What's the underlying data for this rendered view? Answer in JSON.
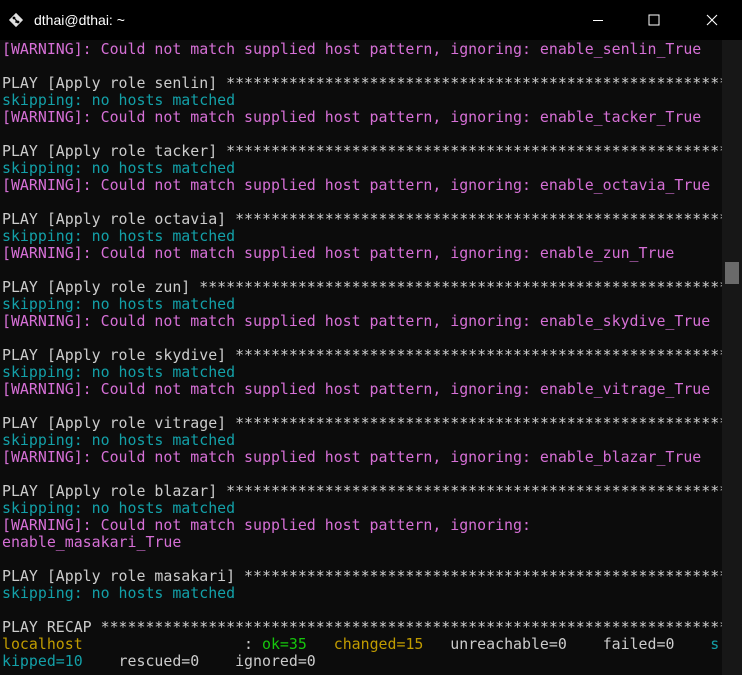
{
  "window": {
    "title": "dthai@dthai: ~"
  },
  "colors": {
    "warning": "#d670d6",
    "skipping": "#13a0a8",
    "normal": "#cccccc",
    "ok": "#16c60c",
    "changed": "#c19c00",
    "host": "#c19c00"
  },
  "lines": [
    {
      "segments": [
        {
          "text": "[WARNING]: Could not match supplied host pattern, ignoring: enable_senlin_True",
          "color": "#d670d6"
        }
      ]
    },
    {
      "segments": []
    },
    {
      "segments": [
        {
          "text": "PLAY [Apply role senlin] ********************************************************",
          "color": "#cccccc"
        }
      ]
    },
    {
      "segments": [
        {
          "text": "skipping: no hosts matched",
          "color": "#13a0a8"
        }
      ]
    },
    {
      "segments": [
        {
          "text": "[WARNING]: Could not match supplied host pattern, ignoring: enable_tacker_True",
          "color": "#d670d6"
        }
      ]
    },
    {
      "segments": []
    },
    {
      "segments": [
        {
          "text": "PLAY [Apply role tacker] ********************************************************",
          "color": "#cccccc"
        }
      ]
    },
    {
      "segments": [
        {
          "text": "skipping: no hosts matched",
          "color": "#13a0a8"
        }
      ]
    },
    {
      "segments": [
        {
          "text": "[WARNING]: Could not match supplied host pattern, ignoring: enable_octavia_True",
          "color": "#d670d6"
        }
      ]
    },
    {
      "segments": []
    },
    {
      "segments": [
        {
          "text": "PLAY [Apply role octavia] *******************************************************",
          "color": "#cccccc"
        }
      ]
    },
    {
      "segments": [
        {
          "text": "skipping: no hosts matched",
          "color": "#13a0a8"
        }
      ]
    },
    {
      "segments": [
        {
          "text": "[WARNING]: Could not match supplied host pattern, ignoring: enable_zun_True",
          "color": "#d670d6"
        }
      ]
    },
    {
      "segments": []
    },
    {
      "segments": [
        {
          "text": "PLAY [Apply role zun] ***********************************************************",
          "color": "#cccccc"
        }
      ]
    },
    {
      "segments": [
        {
          "text": "skipping: no hosts matched",
          "color": "#13a0a8"
        }
      ]
    },
    {
      "segments": [
        {
          "text": "[WARNING]: Could not match supplied host pattern, ignoring: enable_skydive_True",
          "color": "#d670d6"
        }
      ]
    },
    {
      "segments": []
    },
    {
      "segments": [
        {
          "text": "PLAY [Apply role skydive] *******************************************************",
          "color": "#cccccc"
        }
      ]
    },
    {
      "segments": [
        {
          "text": "skipping: no hosts matched",
          "color": "#13a0a8"
        }
      ]
    },
    {
      "segments": [
        {
          "text": "[WARNING]: Could not match supplied host pattern, ignoring: enable_vitrage_True",
          "color": "#d670d6"
        }
      ]
    },
    {
      "segments": []
    },
    {
      "segments": [
        {
          "text": "PLAY [Apply role vitrage] *******************************************************",
          "color": "#cccccc"
        }
      ]
    },
    {
      "segments": [
        {
          "text": "skipping: no hosts matched",
          "color": "#13a0a8"
        }
      ]
    },
    {
      "segments": [
        {
          "text": "[WARNING]: Could not match supplied host pattern, ignoring: enable_blazar_True",
          "color": "#d670d6"
        }
      ]
    },
    {
      "segments": []
    },
    {
      "segments": [
        {
          "text": "PLAY [Apply role blazar] ********************************************************",
          "color": "#cccccc"
        }
      ]
    },
    {
      "segments": [
        {
          "text": "skipping: no hosts matched",
          "color": "#13a0a8"
        }
      ]
    },
    {
      "segments": [
        {
          "text": "[WARNING]: Could not match supplied host pattern, ignoring:",
          "color": "#d670d6"
        }
      ]
    },
    {
      "segments": [
        {
          "text": "enable_masakari_True",
          "color": "#d670d6"
        }
      ]
    },
    {
      "segments": []
    },
    {
      "segments": [
        {
          "text": "PLAY [Apply role masakari] ******************************************************",
          "color": "#cccccc"
        }
      ]
    },
    {
      "segments": [
        {
          "text": "skipping: no hosts matched",
          "color": "#13a0a8"
        }
      ]
    },
    {
      "segments": []
    },
    {
      "segments": [
        {
          "text": "PLAY RECAP **********************************************************************",
          "color": "#cccccc"
        }
      ]
    },
    {
      "segments": [
        {
          "text": "localhost",
          "color": "#c19c00"
        },
        {
          "text": "                  : ",
          "color": "#cccccc"
        },
        {
          "text": "ok=35",
          "color": "#16c60c"
        },
        {
          "text": "   ",
          "color": "#cccccc"
        },
        {
          "text": "changed=15",
          "color": "#c19c00"
        },
        {
          "text": "   unreachable=0    failed=0    ",
          "color": "#cccccc"
        },
        {
          "text": "s",
          "color": "#13a0a8"
        }
      ]
    },
    {
      "segments": [
        {
          "text": "kipped=10",
          "color": "#13a0a8"
        },
        {
          "text": "    rescued=0    ignored=0",
          "color": "#cccccc"
        }
      ]
    }
  ]
}
